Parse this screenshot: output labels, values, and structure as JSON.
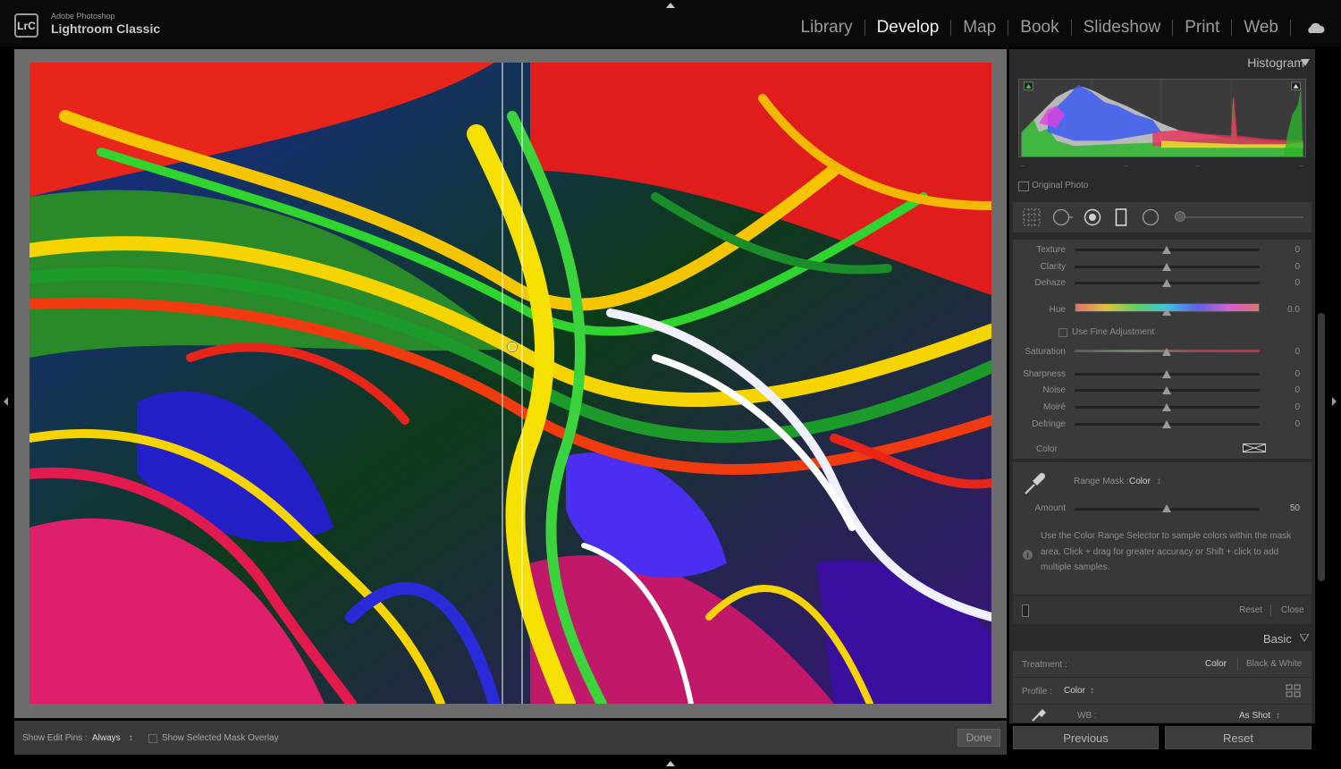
{
  "app": {
    "brand_small": "Adobe Photoshop",
    "brand_name": "Lightroom Classic",
    "logo_text": "LrC"
  },
  "modules": [
    {
      "label": "Library",
      "active": false
    },
    {
      "label": "Develop",
      "active": true
    },
    {
      "label": "Map",
      "active": false
    },
    {
      "label": "Book",
      "active": false
    },
    {
      "label": "Slideshow",
      "active": false
    },
    {
      "label": "Print",
      "active": false
    },
    {
      "label": "Web",
      "active": false
    }
  ],
  "toolbar": {
    "show_edit_pins_label": "Show Edit Pins :",
    "show_edit_pins_value": "Always",
    "show_mask_overlay_label": "Show Selected Mask Overlay",
    "done_label": "Done"
  },
  "histogram": {
    "title": "Histogram",
    "original_photo_label": "Original Photo"
  },
  "sliders": [
    {
      "label": "Texture",
      "value": "0",
      "kind": "plain"
    },
    {
      "label": "Clarity",
      "value": "0",
      "kind": "plain"
    },
    {
      "label": "Dehaze",
      "value": "0",
      "kind": "plain"
    },
    {
      "label": "Hue",
      "value": "0.0",
      "kind": "hue"
    },
    {
      "label": "Saturation",
      "value": "0",
      "kind": "saturation"
    },
    {
      "label": "Sharpness",
      "value": "0",
      "kind": "plain"
    },
    {
      "label": "Noise",
      "value": "0",
      "kind": "plain"
    },
    {
      "label": "Moiré",
      "value": "0",
      "kind": "plain"
    },
    {
      "label": "Defringe",
      "value": "0",
      "kind": "plain"
    }
  ],
  "fine_adjustment_label": "Use Fine Adjustment",
  "color_label": "Color",
  "range_mask": {
    "label": "Range Mask :",
    "value": "Color",
    "amount_label": "Amount",
    "amount_value": "50",
    "info_line1": "Use the Color Range Selector to sample colors within the mask",
    "info_line2": "area. Click + drag for greater accuracy or Shift + click to add",
    "info_line3": "multiple samples.",
    "reset_label": "Reset",
    "close_label": "Close"
  },
  "basic": {
    "title": "Basic",
    "treatment_label": "Treatment :",
    "treatment_color": "Color",
    "treatment_bw": "Black & White",
    "profile_label": "Profile :",
    "profile_value": "Color",
    "wb_label": "WB :",
    "wb_value": "As Shot"
  },
  "bottom_buttons": {
    "previous": "Previous",
    "reset": "Reset"
  },
  "colors": {
    "accent_active": "#f2f2f2",
    "panel_bg": "#2a2a2a",
    "image_bg": "#6c6c6c"
  }
}
